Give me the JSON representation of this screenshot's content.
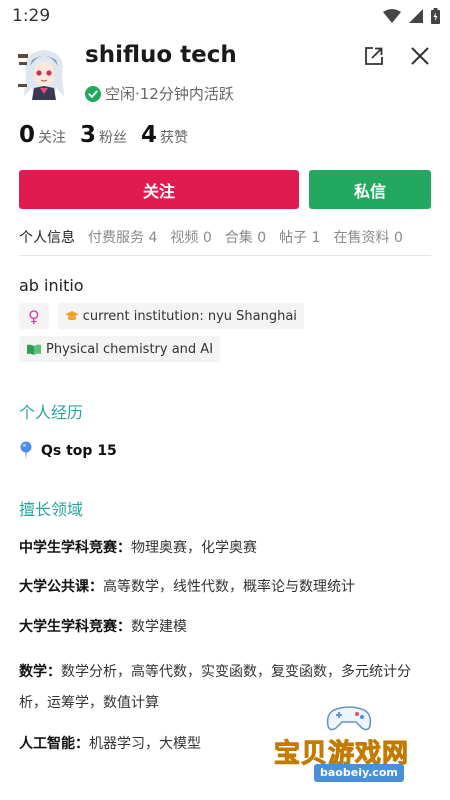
{
  "status_bar": {
    "time": "1:29"
  },
  "profile": {
    "name": "shifluo tech",
    "presence_text": "空闲·12分钟内活跃",
    "status_color": "#22a95f"
  },
  "stats": [
    {
      "value": "0",
      "label": "关注"
    },
    {
      "value": "3",
      "label": "粉丝"
    },
    {
      "value": "4",
      "label": "获赞"
    }
  ],
  "actions": {
    "follow_label": "关注",
    "message_label": "私信",
    "follow_color": "#e01b4f",
    "message_color": "#22a95f"
  },
  "tabs": [
    {
      "label": "个人信息",
      "count": "",
      "active": true
    },
    {
      "label": "付费服务",
      "count": "4"
    },
    {
      "label": "视频",
      "count": "0"
    },
    {
      "label": "合集",
      "count": "0"
    },
    {
      "label": "帖子",
      "count": "1"
    },
    {
      "label": "在售资料",
      "count": "0"
    }
  ],
  "bio": "ab initio",
  "chips": {
    "gender_symbol": "♀",
    "institution": "current institution: nyu Shanghai",
    "field": "Physical chemistry and AI"
  },
  "experience": {
    "title": "个人经历",
    "item": "Qs top 15"
  },
  "expertise": {
    "title": "擅长领域",
    "items": [
      {
        "key": "中学生学科竞赛：",
        "value": "物理奥赛，化学奥赛"
      },
      {
        "key": "大学公共课：",
        "value": "高等数学，线性代数，概率论与数理统计"
      },
      {
        "key": "大学生学科竞赛：",
        "value": "数学建模"
      },
      {
        "key": "数学：",
        "value": "数学分析，高等代数，实变函数，复变函数，多元统计分析，运筹学，数值计算"
      },
      {
        "key": "人工智能：",
        "value": "机器学习，大模型"
      }
    ]
  },
  "watermark": {
    "title": "宝贝游戏网",
    "url": "baobeiy.com"
  },
  "accent_color": "#2aa6a0"
}
